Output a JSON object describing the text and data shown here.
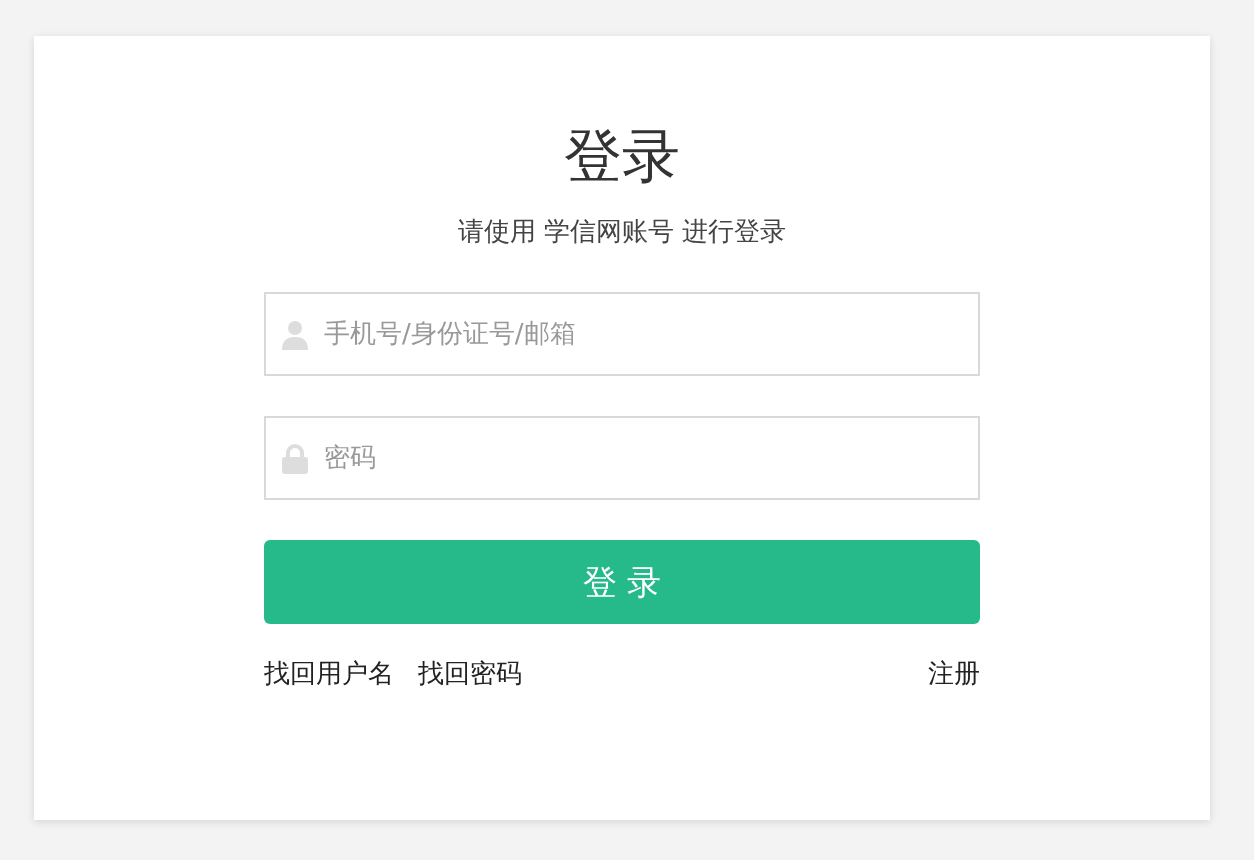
{
  "title": "登录",
  "subtitle": "请使用 学信网账号 进行登录",
  "fields": [
    {
      "kind": "user",
      "placeholder": "手机号/身份证号/邮箱"
    },
    {
      "kind": "password",
      "placeholder": "密码"
    }
  ],
  "submit": "登 录",
  "links_left": [
    "找回用户名",
    "找回密码"
  ],
  "link_right": "注册"
}
